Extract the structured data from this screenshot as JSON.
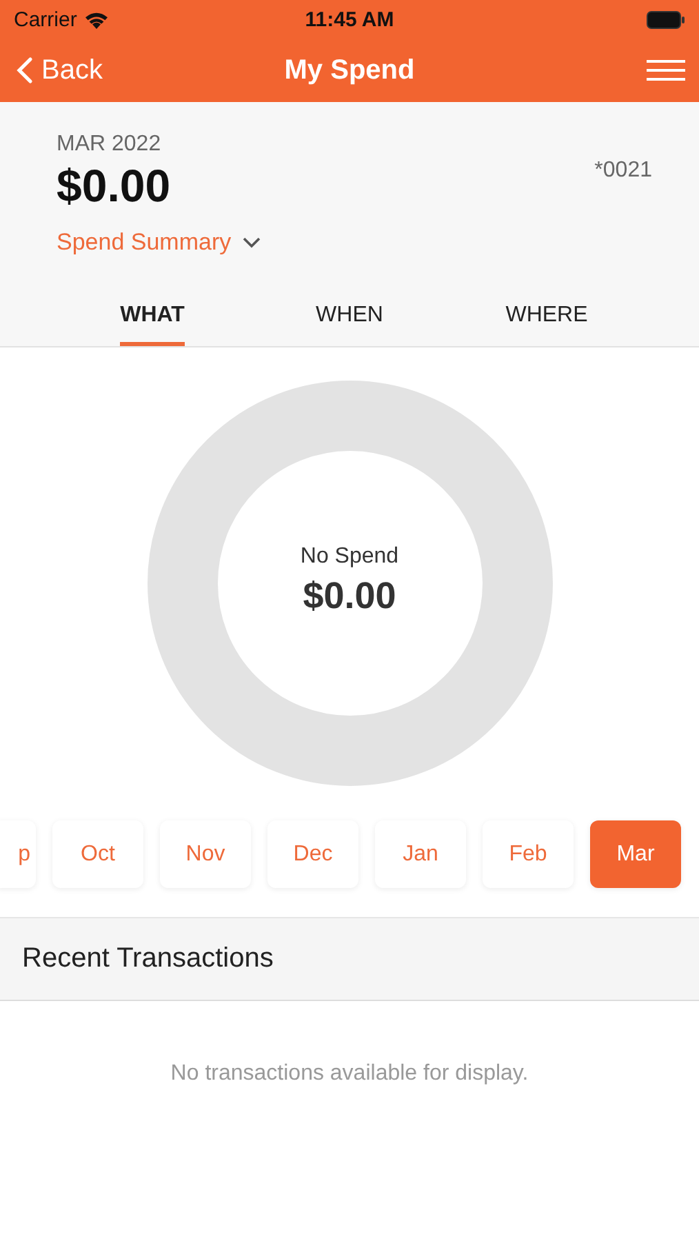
{
  "status_bar": {
    "carrier": "Carrier",
    "time": "11:45 AM"
  },
  "nav": {
    "back": "Back",
    "title": "My Spend"
  },
  "summary": {
    "period": "MAR 2022",
    "amount": "$0.00",
    "account": "*0021",
    "dropdown": "Spend Summary"
  },
  "tabs": [
    {
      "label": "WHAT",
      "selected": true
    },
    {
      "label": "WHEN",
      "selected": false
    },
    {
      "label": "WHERE",
      "selected": false
    }
  ],
  "donut": {
    "label": "No Spend",
    "amount": "$0.00"
  },
  "months": [
    {
      "label": "p",
      "selected": false
    },
    {
      "label": "Oct",
      "selected": false
    },
    {
      "label": "Nov",
      "selected": false
    },
    {
      "label": "Dec",
      "selected": false
    },
    {
      "label": "Jan",
      "selected": false
    },
    {
      "label": "Feb",
      "selected": false
    },
    {
      "label": "Mar",
      "selected": true
    }
  ],
  "recent": {
    "title": "Recent Transactions",
    "empty": "No transactions available for display."
  }
}
